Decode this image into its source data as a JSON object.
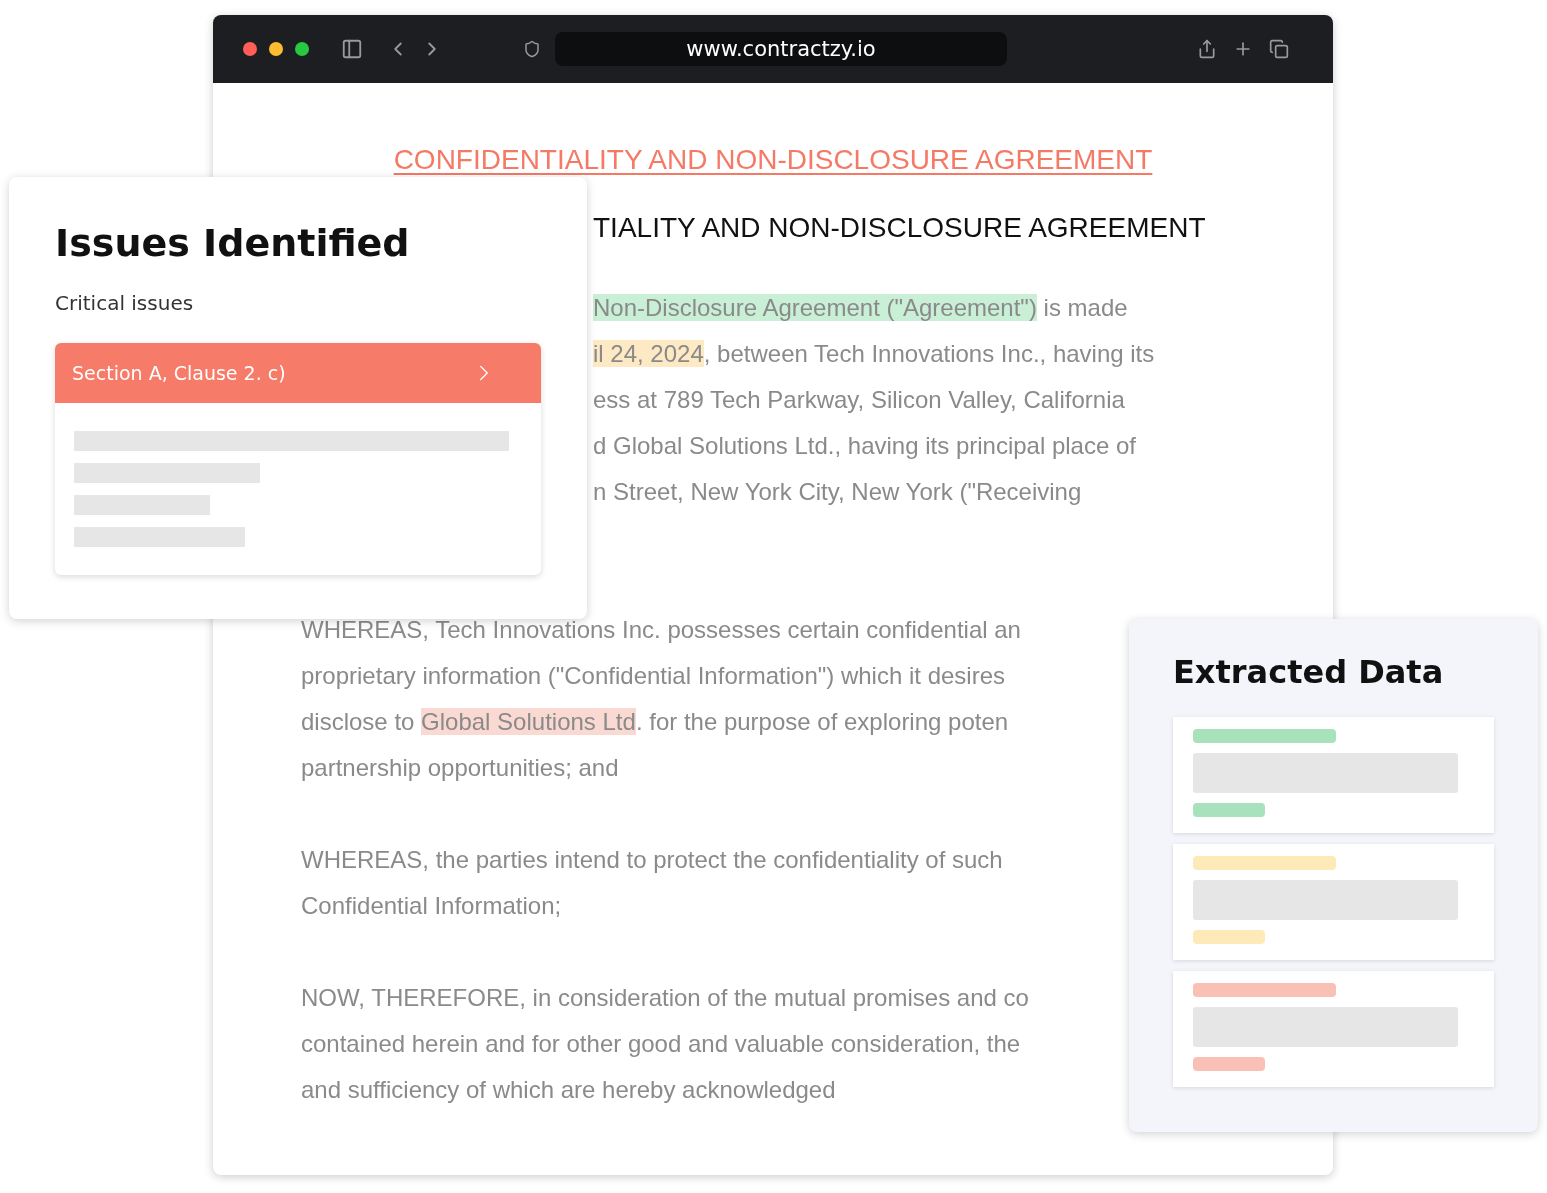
{
  "browser": {
    "url": "www.contractzy.io"
  },
  "document": {
    "title": "CONFIDENTIALITY AND NON-DISCLOSURE AGREEMENT",
    "heading": "TIALITY AND NON-DISCLOSURE AGREEMENT",
    "paragraphs": [
      {
        "kind": "covered",
        "lines": [
          [
            {
              "text": "Non-Disclosure Agreement (\"Agreement\")",
              "color": "#c9efd6"
            },
            {
              "text": " is made"
            }
          ],
          [
            {
              "text": "il 24, 2024",
              "color": "#fde9c4"
            },
            {
              "text": ", between Tech Innovations Inc., having its"
            }
          ],
          [
            {
              "text": "ess at 789 Tech Parkway, Silicon Valley, California"
            }
          ],
          [
            {
              "text": "d Global Solutions Ltd., having its principal place of"
            }
          ],
          [
            {
              "text": "n Street, New York City, New York (\"Receiving"
            }
          ]
        ]
      },
      {
        "kind": "plain",
        "lines": [
          [
            {
              "text": "WHEREAS, Tech Innovations Inc. possesses certain confidential an"
            }
          ],
          [
            {
              "text": "proprietary information (\"Confidential Information\") which it desires"
            }
          ],
          [
            {
              "text": "disclose to "
            },
            {
              "text": "Global Solutions Ltd",
              "color": "#fbd9d3"
            },
            {
              "text": ". for the purpose of exploring poten"
            }
          ],
          [
            {
              "text": "partnership opportunities; and"
            }
          ]
        ]
      },
      {
        "kind": "plain",
        "lines": [
          [
            {
              "text": "WHEREAS, the parties intend to protect the confidentiality of such"
            }
          ],
          [
            {
              "text": "Confidential Information;"
            }
          ]
        ]
      },
      {
        "kind": "plain",
        "lines": [
          [
            {
              "text": "NOW, THEREFORE, in consideration of the mutual promises and co"
            }
          ],
          [
            {
              "text": "contained herein and for other good and valuable consideration, the"
            }
          ],
          [
            {
              "text": "and sufficiency of which are hereby acknowledged"
            }
          ]
        ]
      }
    ]
  },
  "issues": {
    "title": "Issues Identified",
    "subtitle": "Critical issues",
    "item": {
      "label": "Section A, Clause 2. c)",
      "expanded": true
    }
  },
  "extracted": {
    "title": "Extracted Data",
    "cards": [
      {
        "color": "#a8e2bd"
      },
      {
        "color": "#fdeab8"
      },
      {
        "color": "#f9c0b6"
      }
    ]
  }
}
